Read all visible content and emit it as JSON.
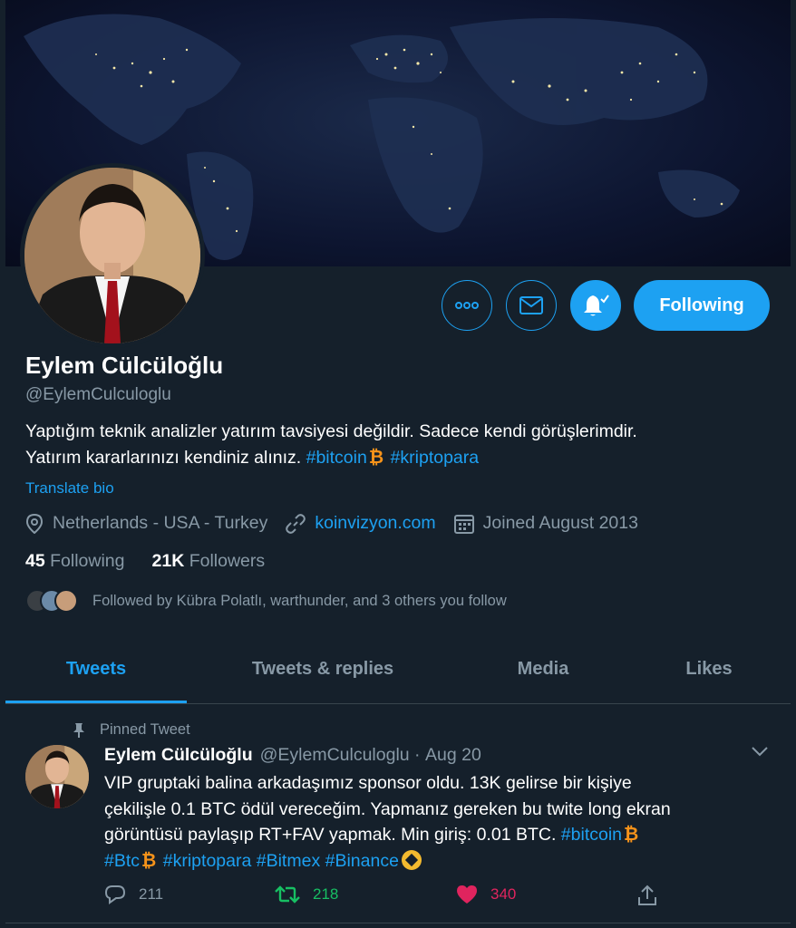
{
  "profile": {
    "name": "Eylem Cülcüloğlu",
    "handle": "@EylemCulculoglu",
    "bio_line1": "Yaptığım teknik analizler yatırım tavsiyesi değildir. Sadece kendi görüşlerimdir.",
    "bio_line2": "Yatırım kararlarınızı kendiniz alınız.",
    "bio_tag1": "#bitcoin",
    "bio_tag2": "#kriptopara",
    "translate": "Translate bio",
    "location": "Netherlands - USA - Turkey",
    "website": "koinvizyon.com",
    "joined": "Joined August 2013",
    "following_count": "45",
    "following_label": "Following",
    "followers_count": "21K",
    "followers_label": "Followers",
    "followed_by": "Followed by Kübra Polatlı, warthunder, and 3 others you follow"
  },
  "actions": {
    "follow_label": "Following",
    "more_icon": "more-icon",
    "message_icon": "envelope-icon",
    "notify_icon": "bell-icon"
  },
  "tabs": [
    {
      "label": "Tweets",
      "active": true
    },
    {
      "label": "Tweets & replies"
    },
    {
      "label": "Media"
    },
    {
      "label": "Likes"
    }
  ],
  "tweet": {
    "pinned_label": "Pinned Tweet",
    "name": "Eylem Cülcüloğlu",
    "handle": "@EylemCulculoglu",
    "date": "Aug 20",
    "line1": "VIP gruptaki balina arkadaşımız sponsor oldu. 13K gelirse bir kişiye",
    "line2": "çekilişle 0.1 BTC ödül vereceğim. Yapmanız gereken bu twite long ekran",
    "line3": "görüntüsü paylaşıp RT+FAV yapmak. Min giriş: 0.01 BTC.",
    "tag_bitcoin": "#bitcoin",
    "tag_btc": "#Btc",
    "tag_kriptopara": "#kriptopara",
    "tag_bitmex": "#Bitmex",
    "tag_binance": "#Binance",
    "replies": "211",
    "retweets": "218",
    "likes": "340"
  },
  "colors": {
    "background": "#15202b",
    "accent": "#1da1f2",
    "muted": "#8899a6",
    "retweet": "#17bf63",
    "like": "#e0245e",
    "bitcoin": "#f7931a"
  }
}
